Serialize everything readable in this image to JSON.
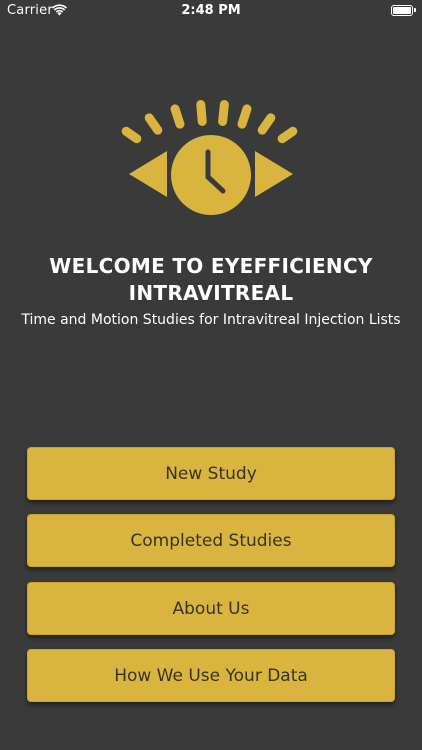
{
  "status_bar": {
    "carrier": "Carrier",
    "time": "2:48 PM"
  },
  "brand": {
    "accent_color": "#d9b53f",
    "background_color": "#3a3a3a",
    "logo_icon": "eye-clock-icon"
  },
  "header": {
    "title": "WELCOME TO EYEFFICIENCY INTRAVITREAL",
    "subtitle": "Time and Motion Studies for Intravitreal Injection Lists"
  },
  "menu": {
    "new_study": "New Study",
    "completed_studies": "Completed Studies",
    "about_us": "About Us",
    "data_use": "How We Use Your Data"
  }
}
